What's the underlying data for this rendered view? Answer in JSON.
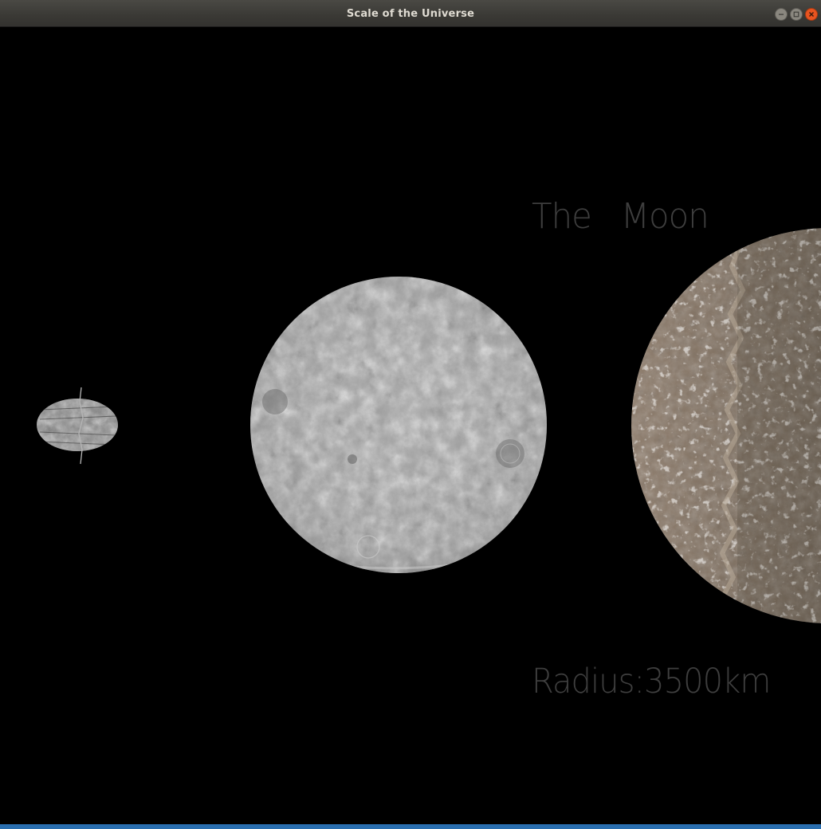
{
  "window": {
    "title": "Scale of the Universe",
    "buttons": {
      "minimize": "minimize-icon",
      "maximize": "maximize-icon",
      "close": "close-icon"
    }
  },
  "scene": {
    "object_name": "The   Moon",
    "radius_label": "Radius:3500km",
    "bodies": [
      {
        "name": "small-asteroid",
        "color": "#8c8c8c"
      },
      {
        "name": "the-moon",
        "color": "#a3a3a3"
      },
      {
        "name": "callisto-like-moon",
        "color": "#7a6b5d"
      }
    ]
  },
  "colors": {
    "background": "#000000",
    "label": "#3e3e3e",
    "close_button": "#e95420",
    "titlebar": "#3c3b37"
  }
}
